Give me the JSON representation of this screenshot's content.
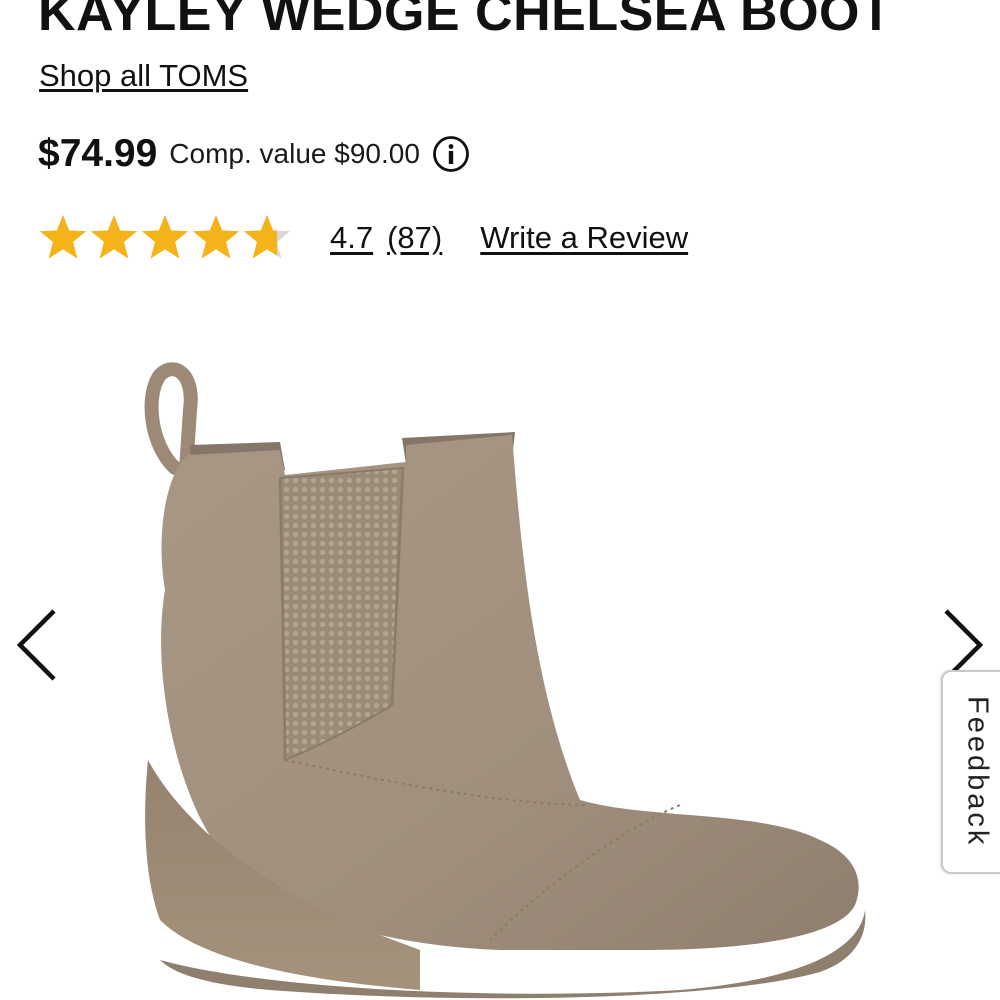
{
  "product": {
    "title": "KAYLEY WEDGE CHELSEA BOOT",
    "brand_link": "Shop all TOMS",
    "price": "$74.99",
    "comp_value": "Comp. value $90.00"
  },
  "rating": {
    "value": "4.7",
    "count": "(87)",
    "stars": 4.7,
    "star_max": 5,
    "write_review": "Write a Review"
  },
  "icons": {
    "info": "info-circle-icon",
    "star": "star-icon",
    "prev": "chevron-left-icon",
    "next": "chevron-right-icon"
  },
  "feedback": {
    "label": "Feedback"
  },
  "colors": {
    "star_fill": "#f5b31a",
    "star_empty": "#d8d8d8",
    "boot_suede": "#a0907f",
    "text": "#111111"
  }
}
